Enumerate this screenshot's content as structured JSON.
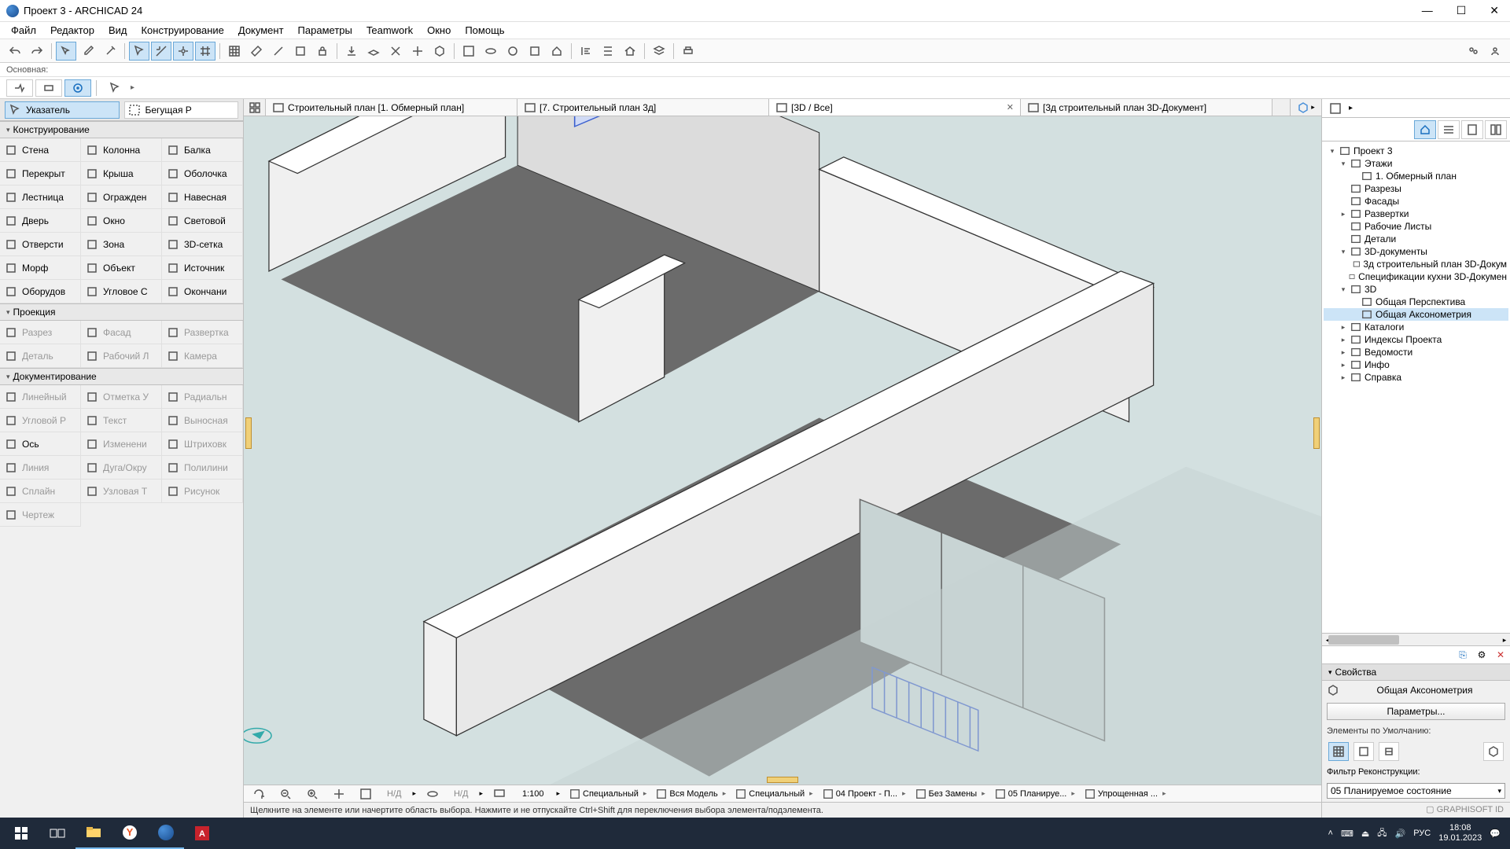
{
  "title": "Проект 3 - ARCHICAD 24",
  "menu": [
    "Файл",
    "Редактор",
    "Вид",
    "Конструирование",
    "Документ",
    "Параметры",
    "Teamwork",
    "Окно",
    "Помощь"
  ],
  "strip_label": "Основная:",
  "toolbox": {
    "pointer": "Указатель",
    "marquee": "Бегущая Р",
    "sections": {
      "s1": "Конструирование",
      "s2": "Проекция",
      "s3": "Документирование"
    },
    "construct": [
      {
        "l": "Стена"
      },
      {
        "l": "Колонна"
      },
      {
        "l": "Балка"
      },
      {
        "l": "Перекрыт"
      },
      {
        "l": "Крыша"
      },
      {
        "l": "Оболочка"
      },
      {
        "l": "Лестница"
      },
      {
        "l": "Огражден"
      },
      {
        "l": "Навесная"
      },
      {
        "l": "Дверь"
      },
      {
        "l": "Окно"
      },
      {
        "l": "Световой"
      },
      {
        "l": "Отверсти"
      },
      {
        "l": "Зона"
      },
      {
        "l": "3D-сетка"
      },
      {
        "l": "Морф"
      },
      {
        "l": "Объект"
      },
      {
        "l": "Источник"
      },
      {
        "l": "Оборудов"
      },
      {
        "l": "Угловое С"
      },
      {
        "l": "Окончани"
      }
    ],
    "projection": [
      {
        "l": "Разрез",
        "d": true
      },
      {
        "l": "Фасад",
        "d": true
      },
      {
        "l": "Развертка",
        "d": true
      },
      {
        "l": "Деталь",
        "d": true
      },
      {
        "l": "Рабочий Л",
        "d": true
      },
      {
        "l": "Камера",
        "d": true
      }
    ],
    "document": [
      {
        "l": "Линейный",
        "d": true
      },
      {
        "l": "Отметка У",
        "d": true
      },
      {
        "l": "Радиальн",
        "d": true
      },
      {
        "l": "Угловой Р",
        "d": true
      },
      {
        "l": "Текст",
        "d": true
      },
      {
        "l": "Выносная",
        "d": true
      },
      {
        "l": "Ось",
        "d": false
      },
      {
        "l": "Изменени",
        "d": true
      },
      {
        "l": "Штриховк",
        "d": true
      },
      {
        "l": "Линия",
        "d": true
      },
      {
        "l": "Дуга/Окру",
        "d": true
      },
      {
        "l": "Полилини",
        "d": true
      },
      {
        "l": "Сплайн",
        "d": true
      },
      {
        "l": "Узловая Т",
        "d": true
      },
      {
        "l": "Рисунок",
        "d": true
      },
      {
        "l": "Чертеж",
        "d": true
      }
    ]
  },
  "tabs": [
    {
      "label": "Строительный план [1. Обмерный план]",
      "icon": "floorplan"
    },
    {
      "label": "[7. Строительный план 3д]",
      "icon": "floorplan"
    },
    {
      "label": "[3D / Все]",
      "icon": "3d",
      "active": true
    },
    {
      "label": "[3д строительный план 3D-Документ]",
      "icon": "doc3d"
    }
  ],
  "navigator": {
    "root": "Проект 3",
    "items": [
      {
        "lvl": 0,
        "caret": "▾",
        "icon": "home",
        "label": "Проект 3"
      },
      {
        "lvl": 1,
        "caret": "▾",
        "icon": "folder",
        "label": "Этажи"
      },
      {
        "lvl": 2,
        "caret": "",
        "icon": "folder",
        "label": "1. Обмерный план"
      },
      {
        "lvl": 1,
        "caret": "",
        "icon": "sheet",
        "label": "Разрезы"
      },
      {
        "lvl": 1,
        "caret": "",
        "icon": "sheet",
        "label": "Фасады"
      },
      {
        "lvl": 1,
        "caret": "▸",
        "icon": "sheet",
        "label": "Развертки"
      },
      {
        "lvl": 1,
        "caret": "",
        "icon": "sheet",
        "label": "Рабочие Листы"
      },
      {
        "lvl": 1,
        "caret": "",
        "icon": "sheet",
        "label": "Детали"
      },
      {
        "lvl": 1,
        "caret": "▾",
        "icon": "cube",
        "label": "3D-документы"
      },
      {
        "lvl": 2,
        "caret": "",
        "icon": "cube",
        "label": "3д строительный план 3D-Докум"
      },
      {
        "lvl": 2,
        "caret": "",
        "icon": "cube",
        "label": "Спецификации кухни 3D-Докумен"
      },
      {
        "lvl": 1,
        "caret": "▾",
        "icon": "cube",
        "label": "3D"
      },
      {
        "lvl": 2,
        "caret": "",
        "icon": "cube",
        "label": "Общая Перспектива"
      },
      {
        "lvl": 2,
        "caret": "",
        "icon": "cube",
        "label": "Общая Аксонометрия",
        "selected": true
      },
      {
        "lvl": 1,
        "caret": "▸",
        "icon": "list",
        "label": "Каталоги"
      },
      {
        "lvl": 1,
        "caret": "▸",
        "icon": "list",
        "label": "Индексы Проекта"
      },
      {
        "lvl": 1,
        "caret": "▸",
        "icon": "list",
        "label": "Ведомости"
      },
      {
        "lvl": 1,
        "caret": "▸",
        "icon": "info",
        "label": "Инфо"
      },
      {
        "lvl": 1,
        "caret": "▸",
        "icon": "help",
        "label": "Справка"
      }
    ]
  },
  "properties": {
    "header": "Свойства",
    "view_name": "Общая Аксонометрия",
    "params_btn": "Параметры...",
    "defaults_label": "Элементы по Умолчанию:",
    "filter_label": "Фильтр Реконструкции:",
    "filter_value": "05 Планируемое состояние",
    "gsid": "GRAPHISOFT ID"
  },
  "bottombar": {
    "zoom": "1:100",
    "nd1": "Н/Д",
    "nd2": "Н/Д",
    "items": [
      "Специальный",
      "Вся Модель",
      "Специальный",
      "04 Проект - П...",
      "Без Замены",
      "05 Планируе...",
      "Упрощенная ..."
    ]
  },
  "status": "Щелкните на элементе или начертите область выбора. Нажмите и не отпускайте Ctrl+Shift для переключения выбора элемента/подэлемента.",
  "taskbar": {
    "time": "18:08",
    "date": "19.01.2023",
    "lang": "РУС"
  }
}
